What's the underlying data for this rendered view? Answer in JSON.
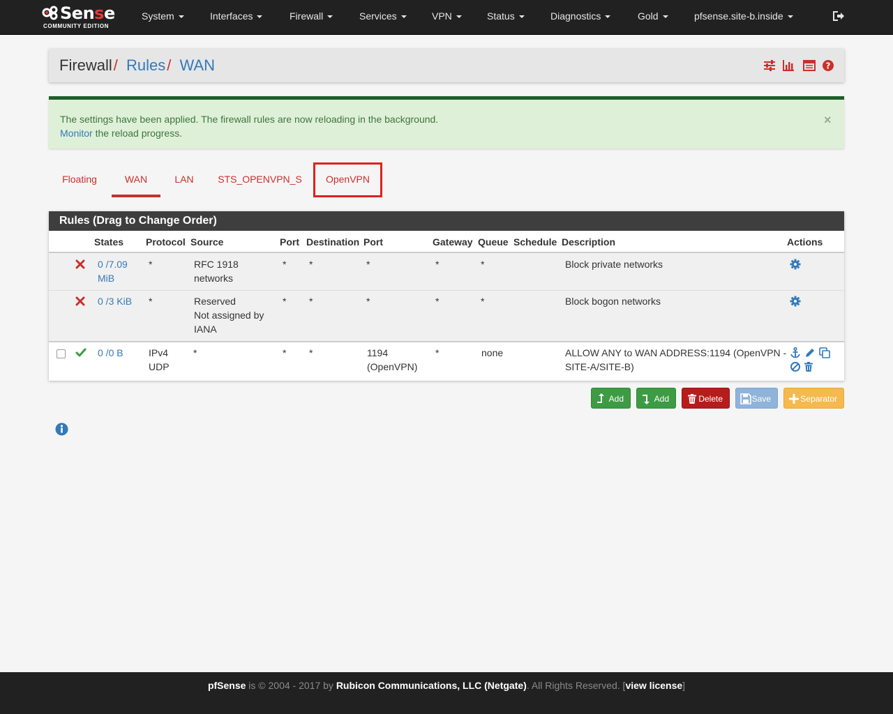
{
  "brand": {
    "logo_prefix": "",
    "logo_mid": "Sen",
    "logo_red": "s",
    "logo_end": "e",
    "edition": "COMMUNITY EDITION"
  },
  "nav": {
    "items": [
      "System",
      "Interfaces",
      "Firewall",
      "Services",
      "VPN",
      "Status",
      "Diagnostics",
      "Gold",
      "pfsense.site-b.inside"
    ]
  },
  "breadcrumb": {
    "part1": "Firewall",
    "part2": "Rules",
    "part3": "WAN",
    "sep": "/"
  },
  "alert": {
    "line1": "The settings have been applied. The firewall rules are now reloading in the background.",
    "link": "Monitor",
    "line2_rest": " the reload progress.",
    "close": "×"
  },
  "tabs": [
    "Floating",
    "WAN",
    "LAN",
    "STS_OPENVPN_S",
    "OpenVPN"
  ],
  "panel": {
    "title": "Rules (Drag to Change Order)",
    "headers": [
      "States",
      "Protocol",
      "Source",
      "Port",
      "Destination",
      "Port",
      "Gateway",
      "Queue",
      "Schedule",
      "Description",
      "Actions"
    ],
    "rows": [
      {
        "states": [
          "0 /7.09",
          "MiB"
        ],
        "protocol": "*",
        "source": [
          "RFC 1918",
          "networks"
        ],
        "src_port": "*",
        "destination": "*",
        "dst_port": "*",
        "gateway": "*",
        "queue": "*",
        "schedule": "",
        "description": "Block private networks"
      },
      {
        "states": [
          "0 /3 KiB"
        ],
        "protocol": "*",
        "source": [
          "Reserved",
          "Not assigned by",
          "IANA"
        ],
        "src_port": "*",
        "destination": "*",
        "dst_port": "*",
        "gateway": "*",
        "queue": "*",
        "schedule": "",
        "description": "Block bogon networks"
      },
      {
        "states": [
          "0 /0 B"
        ],
        "protocol": [
          "IPv4",
          "UDP"
        ],
        "source": [
          "*"
        ],
        "src_port": "*",
        "destination": "*",
        "dst_port": [
          "1194",
          "(OpenVPN)"
        ],
        "gateway": "*",
        "queue": "none",
        "schedule": "",
        "description": [
          "ALLOW ANY to WAN ADDRESS:1194 (OpenVPN -",
          "SITE-A/SITE-B)"
        ]
      }
    ]
  },
  "buttons": {
    "add_top": "Add",
    "add_bottom": "Add",
    "delete": "Delete",
    "save": "Save",
    "separator": "Separator"
  },
  "footer": {
    "brand": "pfSense",
    "text1": " is © 2004 - 2017 by ",
    "company": "Rubicon Communications, LLC (Netgate)",
    "text2": ". All Rights Reserved. [",
    "license": "view license",
    "text3": "]"
  },
  "colors": {
    "navbar": "#212121",
    "accent_red": "#c9302c",
    "link_blue": "#337ab7",
    "alert_bg": "#dff0d8",
    "success_green": "#3d9b44"
  }
}
